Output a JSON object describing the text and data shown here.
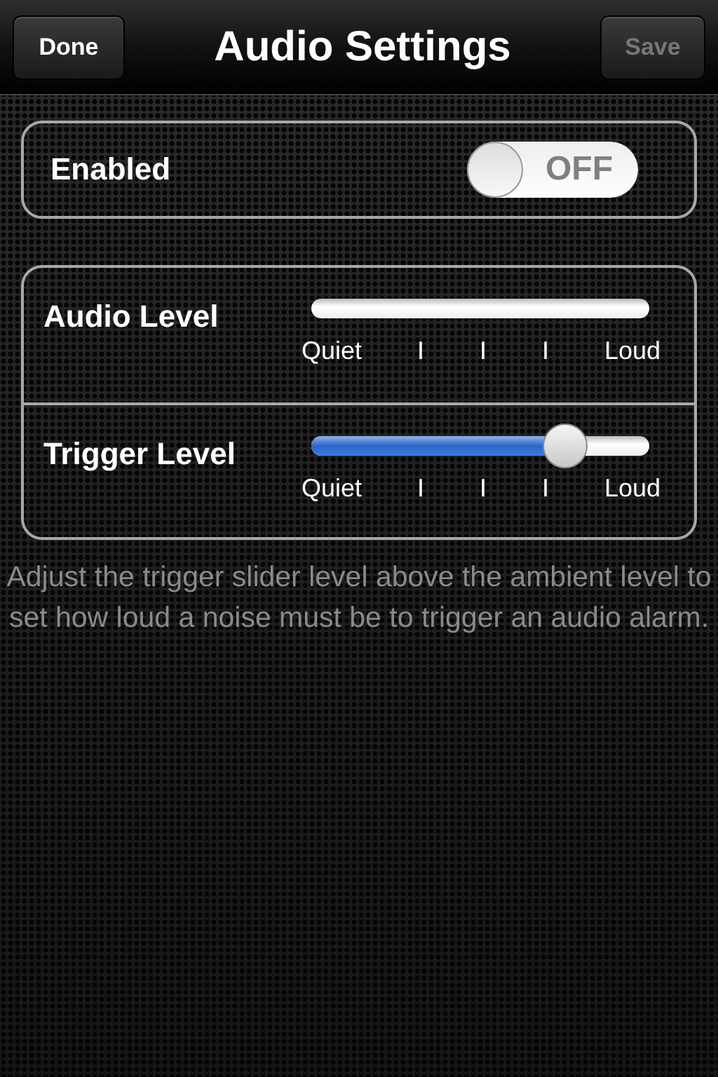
{
  "nav_bar": {
    "title": "Audio Settings",
    "left_button": {
      "label": "Done",
      "disabled": false
    },
    "right_button": {
      "label": "Save",
      "disabled": true
    }
  },
  "enabled_row": {
    "label": "Enabled",
    "toggle": {
      "on": false,
      "label": "OFF"
    }
  },
  "level_rows": [
    {
      "label": "Audio Level",
      "kind": "meter",
      "scale": [
        "Quiet",
        "I",
        "I",
        "I",
        "Loud"
      ]
    },
    {
      "label": "Trigger Level",
      "kind": "slider",
      "level": 0.76,
      "scale": [
        "Quiet",
        "I",
        "I",
        "I",
        "Loud"
      ]
    }
  ],
  "help_text": "Adjust the trigger slider level above the ambient level to set how loud a noise must be to trigger an audio alarm."
}
